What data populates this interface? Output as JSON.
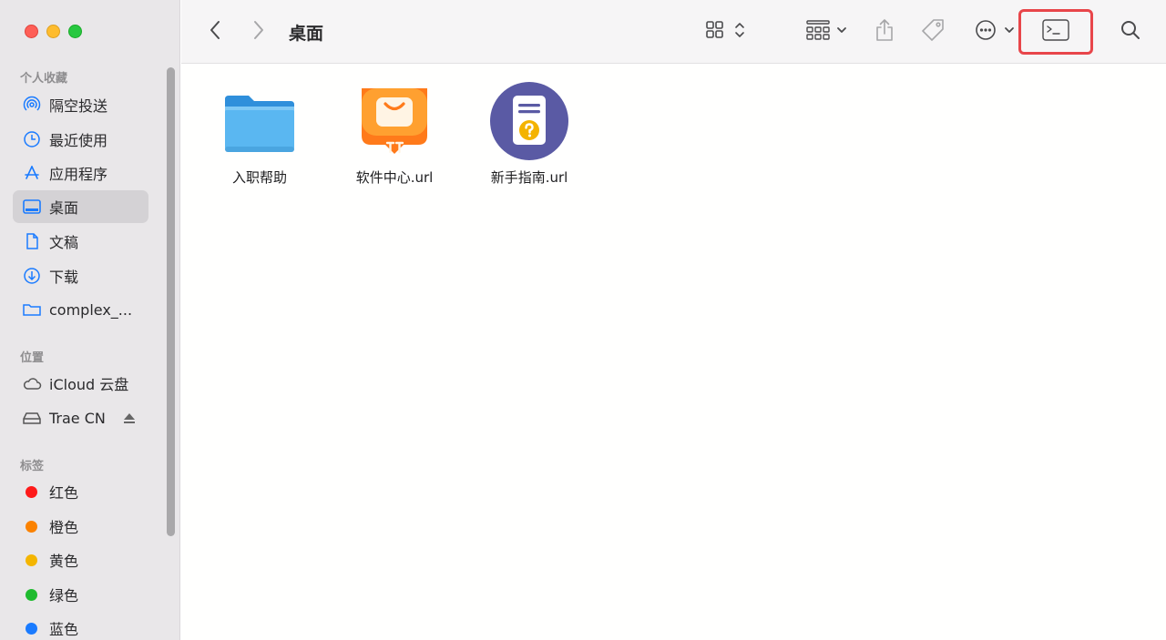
{
  "sidebar": {
    "favorites_title": "个人收藏",
    "favorites": [
      {
        "label": "隔空投送",
        "icon": "airdrop-icon"
      },
      {
        "label": "最近使用",
        "icon": "clock-icon"
      },
      {
        "label": "应用程序",
        "icon": "applications-icon"
      },
      {
        "label": "桌面",
        "icon": "desktop-icon",
        "selected": true
      },
      {
        "label": "文稿",
        "icon": "document-icon"
      },
      {
        "label": "下载",
        "icon": "download-icon"
      },
      {
        "label": "complex_...",
        "icon": "folder-icon"
      }
    ],
    "locations_title": "位置",
    "locations": [
      {
        "label": "iCloud 云盘",
        "icon": "cloud-icon"
      },
      {
        "label": "Trae CN",
        "icon": "drive-icon"
      }
    ],
    "tags_title": "标签",
    "tags": [
      {
        "label": "红色",
        "color": "#fe1a1a"
      },
      {
        "label": "橙色",
        "color": "#fb8200"
      },
      {
        "label": "黄色",
        "color": "#f4b500"
      },
      {
        "label": "绿色",
        "color": "#1fbb2f"
      },
      {
        "label": "蓝色",
        "color": "#1a7bff"
      }
    ]
  },
  "toolbar": {
    "title": "桌面",
    "buttons": [
      "back-icon",
      "forward-icon",
      "icon-view-icon",
      "group-icon",
      "share-icon",
      "tag-icon",
      "more-icon",
      "terminal-icon",
      "search-icon"
    ]
  },
  "files": [
    {
      "label": "入职帮助",
      "icon": "folder-icon"
    },
    {
      "label": "软件中心.url",
      "icon": "software-center-icon"
    },
    {
      "label": "新手指南.url",
      "icon": "guide-icon"
    }
  ],
  "colors": {
    "sidebar_bg": "#e9e7e9",
    "selected_bg": "#d4d2d5",
    "accent": "#1a7bff",
    "highlight_box": "#e8454a"
  }
}
